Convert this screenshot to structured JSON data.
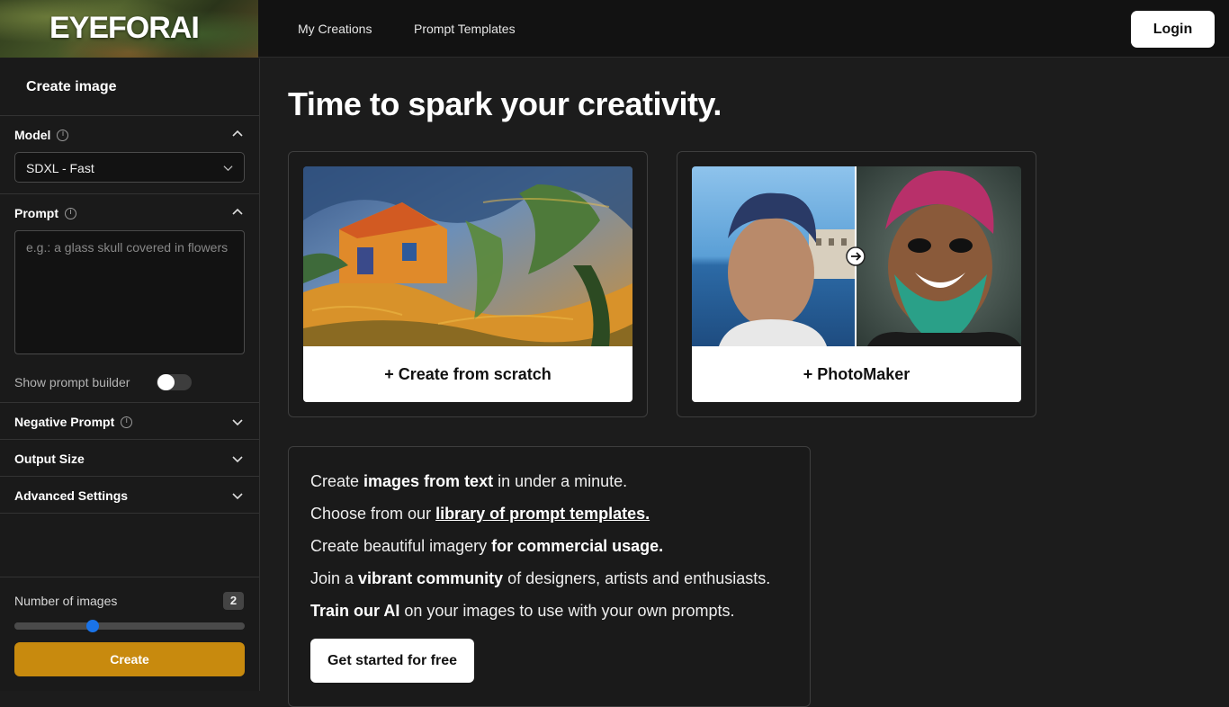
{
  "app": {
    "logo": "EYEFORAI"
  },
  "nav": {
    "items": [
      {
        "label": "My Creations"
      },
      {
        "label": "Prompt Templates"
      }
    ],
    "login": "Login"
  },
  "sidebar": {
    "title": "Create image",
    "model": {
      "label": "Model",
      "value": "SDXL - Fast"
    },
    "prompt": {
      "label": "Prompt",
      "placeholder": "e.g.: a glass skull covered in flowers",
      "value": ""
    },
    "prompt_builder": {
      "label": "Show prompt builder",
      "enabled": false
    },
    "sections": [
      {
        "label": "Negative Prompt"
      },
      {
        "label": "Output Size"
      },
      {
        "label": "Advanced Settings"
      }
    ],
    "num_images": {
      "label": "Number of images",
      "value": "2",
      "slider_fraction": 0.34
    },
    "create": "Create"
  },
  "main": {
    "headline": "Time to spark your creativity.",
    "cards": [
      {
        "label": "+ Create from scratch"
      },
      {
        "label": "+ PhotoMaker"
      }
    ],
    "info": {
      "line1": {
        "a": "Create ",
        "b": "images from text",
        "c": " in under a minute."
      },
      "line2": {
        "a": "Choose from our ",
        "b": "library of prompt templates."
      },
      "line3": {
        "a": "Create beautiful imagery ",
        "b": "for commercial usage."
      },
      "line4": {
        "a": "Join a ",
        "b": "vibrant community",
        "c": " of designers, artists and enthusiasts."
      },
      "line5": {
        "a": "Train our AI",
        "b": " on your images to use with your own prompts."
      },
      "cta": "Get started for free"
    }
  },
  "colors": {
    "accent": "#c88a0e",
    "slider_thumb": "#1a73e8",
    "background": "#1c1c1c"
  }
}
